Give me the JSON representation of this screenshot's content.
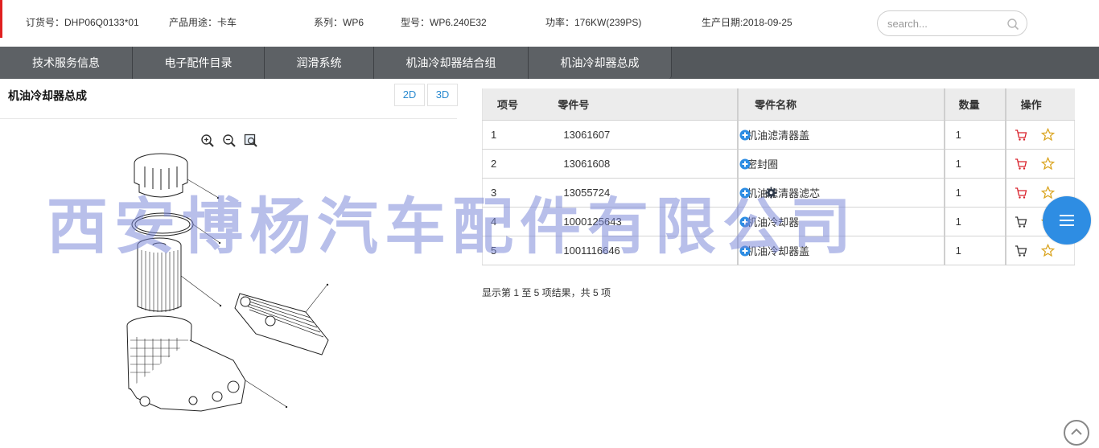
{
  "header": {
    "order_no": "订货号：DHP06Q0133*01",
    "usage": "产品用途：卡车",
    "series": "系列：WP6",
    "model": "型号：WP6.240E32",
    "power": "功率：176KW(239PS)",
    "prod_date": "生产日期:2018-09-25",
    "search_placeholder": "search..."
  },
  "nav": {
    "tabs": [
      {
        "label": "技术服务信息"
      },
      {
        "label": "电子配件目录"
      },
      {
        "label": "润滑系统"
      },
      {
        "label": "机油冷却器结合组"
      },
      {
        "label": "机油冷却器总成"
      }
    ]
  },
  "panel": {
    "title": "机油冷却器总成",
    "btn_2d": "2D",
    "btn_3d": "3D"
  },
  "table": {
    "headers": {
      "index": "项号",
      "part_no": "零件号",
      "part_name": "零件名称",
      "qty": "数量",
      "action": "操作"
    },
    "rows": [
      {
        "index": "1",
        "part_no": "13061607",
        "part_name": "机油滤清器盖",
        "qty": "1",
        "cart_color": "#d9202a"
      },
      {
        "index": "2",
        "part_no": "13061608",
        "part_name": "密封圈",
        "qty": "1",
        "cart_color": "#d9202a"
      },
      {
        "index": "3",
        "part_no": "13055724",
        "part_name": "机油滤清器滤芯",
        "qty": "1",
        "cart_color": "#d9202a",
        "has_gear": true
      },
      {
        "index": "4",
        "part_no": "1000125643",
        "part_name": "机油冷却器",
        "qty": "1",
        "cart_color": "#333333"
      },
      {
        "index": "5",
        "part_no": "1001116646",
        "part_name": "机油冷却器盖",
        "qty": "1",
        "cart_color": "#333333"
      }
    ],
    "summary": "显示第 1 至 5 项结果，共 5 项"
  },
  "watermark": "西安博杨汽车配件有限公司",
  "colors": {
    "accent_blue": "#2e8de3",
    "nav_bg": "#54585c",
    "star": "#d9a21b",
    "header_red": "#e02020"
  },
  "icons": [
    "search-icon",
    "zoom-in-icon",
    "zoom-out-icon",
    "fit-view-icon",
    "plus-circle-icon",
    "gear-icon",
    "cart-icon",
    "star-icon",
    "menu-icon",
    "arrow-up-icon"
  ]
}
